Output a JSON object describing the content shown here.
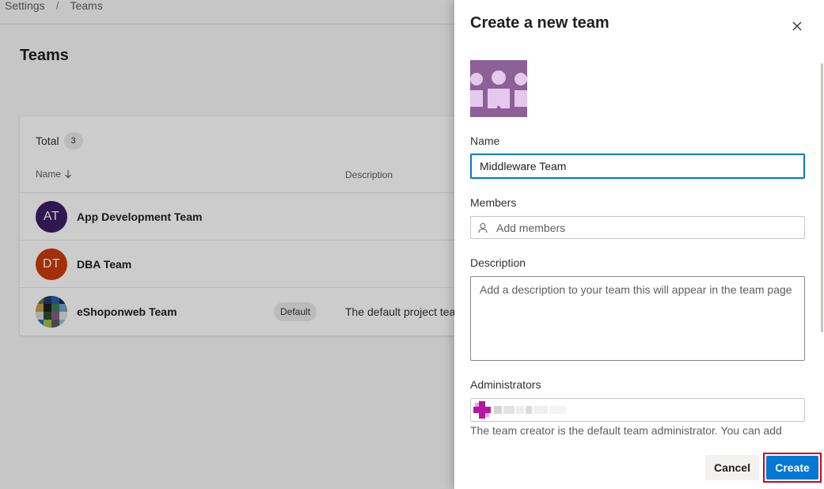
{
  "breadcrumb": {
    "items": [
      "Settings",
      "Teams"
    ],
    "separator": "/"
  },
  "page": {
    "title": "Teams"
  },
  "teams_card": {
    "total_label": "Total",
    "total_count": "3",
    "columns": {
      "name": "Name",
      "description": "Description"
    },
    "rows": [
      {
        "initials": "AT",
        "name": "App Development Team",
        "badge": "",
        "description": "",
        "avatar_color": "#3b1d64"
      },
      {
        "initials": "DT",
        "name": "DBA Team",
        "badge": "",
        "description": "",
        "avatar_color": "#ca3b0b"
      },
      {
        "initials": "",
        "name": "eShoponweb Team",
        "badge": "Default",
        "description": "The default project tea",
        "avatar_color": "#2a2a2a"
      }
    ]
  },
  "panel": {
    "title": "Create a new team",
    "name_label": "Name",
    "name_value": "Middleware Team",
    "members_label": "Members",
    "members_placeholder": "Add members",
    "description_label": "Description",
    "description_placeholder": "Add a description to your team this will appear in the team page",
    "administrators_label": "Administrators",
    "helper_text": "The team creator is the default team administrator. You can add",
    "cancel_label": "Cancel",
    "create_label": "Create"
  },
  "colors": {
    "accent": "#0078d4",
    "team_icon_bg": "#8b6196",
    "team_icon_fg": "#e6c7ee",
    "highlight_border": "#d0021b"
  },
  "icons": {
    "sort": "arrow-down-icon",
    "close": "close-icon",
    "members": "person-icon",
    "team": "team-icon"
  }
}
